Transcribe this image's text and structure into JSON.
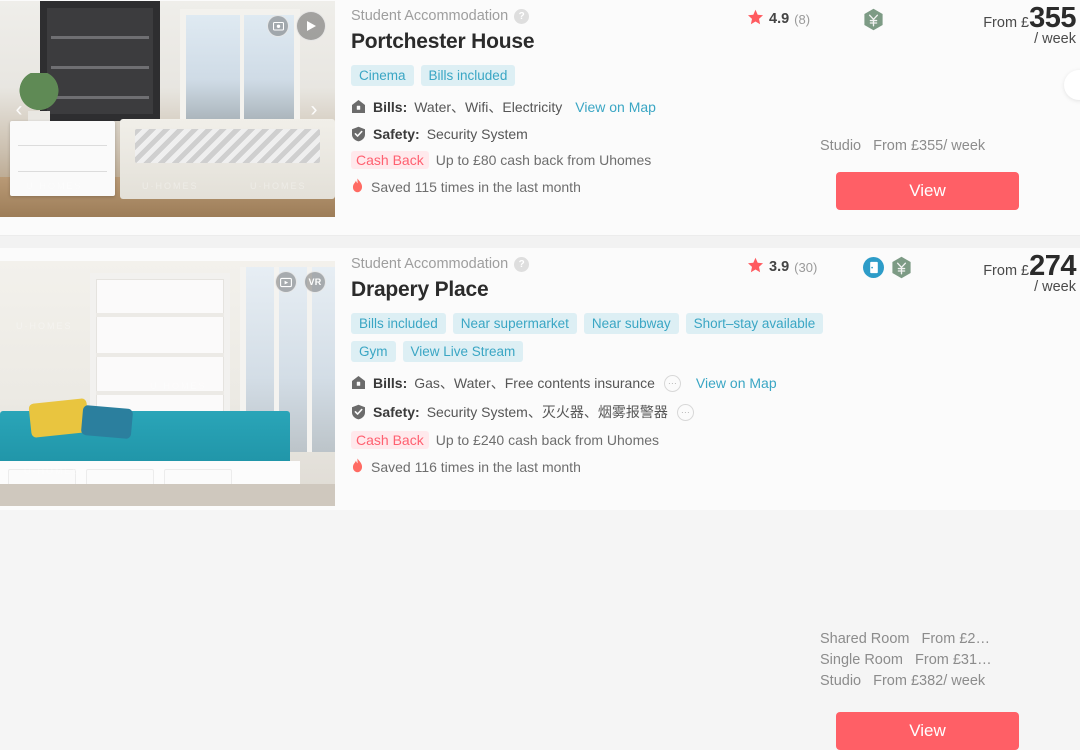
{
  "theme": {
    "accent": "#ff5f66",
    "tag_bg": "#ddeff4",
    "tag_text": "#3aa6c4",
    "badge_green": "#7d9b85",
    "badge_blue": "#2d9cc8",
    "cashback_text": "#ff6070",
    "cashback_bg": "#ffe9ec",
    "page_bg": "#f2f2f2",
    "card_bg": "#fbfbfb"
  },
  "labels": {
    "bills_label": "Bills:",
    "safety_label": "Safety:",
    "cash_back_badge": "Cash Back",
    "view_on_map": "View on Map",
    "view_button": "View",
    "help_mark": "?",
    "more_dots": "···",
    "prev_arrow": "‹",
    "next_arrow": "›",
    "star_glyph": "★",
    "flame_glyph": "♦",
    "vr_label": "VR",
    "watermark": "U·HOMES"
  },
  "cards": [
    {
      "id": "card-0",
      "subtitle": "Student Accommodation",
      "title": "Portchester House",
      "tags": [
        "Cinema",
        "Bills included"
      ],
      "bills": "Water、Wifi、Electricity",
      "bills_has_more": false,
      "safety": "Security System",
      "safety_has_more": false,
      "cash_back_text": "Up to £80 cash back from Uhomes",
      "saved_text": "Saved 115 times in the last month",
      "rating": "4.9",
      "rating_count": "(8)",
      "price_from": "From £",
      "price_amount": "355",
      "price_period": "/ week",
      "badges": [
        "currency-hex"
      ],
      "media_icons": [
        "photo-icon",
        "play-icon"
      ],
      "show_arrows": true,
      "room_types": [
        {
          "name": "Studio",
          "price": "From £355/ week"
        }
      ]
    },
    {
      "id": "card-1",
      "subtitle": "Student Accommodation",
      "title": "Drapery Place",
      "tags": [
        "Bills included",
        "Near supermarket",
        "Near subway",
        "Short–stay available",
        "Gym",
        "View Live Stream"
      ],
      "bills": "Gas、Water、Free contents insurance",
      "bills_has_more": true,
      "safety": "Security System、灭火器、烟雾报警器",
      "safety_has_more": true,
      "cash_back_text": "Up to £240 cash back from Uhomes",
      "saved_text": "Saved 116 times in the last month",
      "rating": "3.9",
      "rating_count": "(30)",
      "price_from": "From £",
      "price_amount": "274",
      "price_period": "/ week",
      "badges": [
        "room-circle",
        "currency-hex"
      ],
      "media_icons": [
        "photo-icon",
        "vr-icon"
      ],
      "show_arrows": false,
      "room_types": [
        {
          "name": "Shared Room",
          "price": "From £2…"
        },
        {
          "name": "Single Room",
          "price": "From £31…"
        },
        {
          "name": "Studio",
          "price": "From £382/ week"
        }
      ]
    }
  ]
}
